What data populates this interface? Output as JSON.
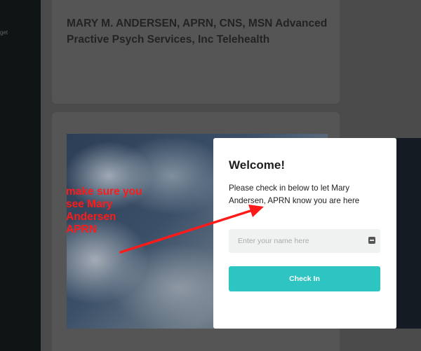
{
  "sidebar": {
    "fragment": "get"
  },
  "provider": {
    "title": "MARY M. ANDERSEN, APRN, CNS, MSN Advanced Practive Psych Services, Inc Telehealth"
  },
  "modal": {
    "title": "Welcome!",
    "message": "Please check in below to let Mary Andersen, APRN know you are here",
    "input_placeholder": "Enter your name here",
    "input_value": "",
    "button_label": "Check In",
    "accent_color": "#2ec4c1"
  },
  "annotation": {
    "text": "make sure you see Mary Andersen APRN",
    "color": "#ff1a1a"
  }
}
